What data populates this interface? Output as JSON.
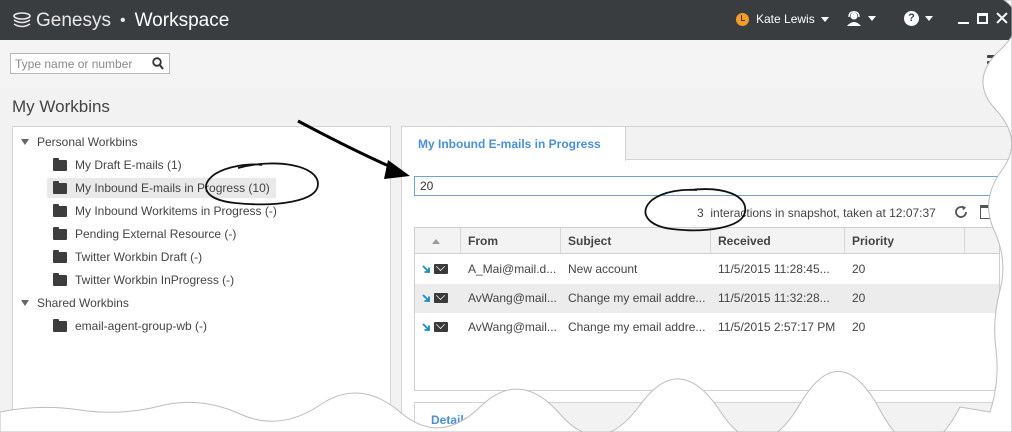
{
  "header": {
    "brand": "Genesys",
    "separator": "•",
    "product": "Workspace",
    "user_name": "Kate Lewis",
    "help_glyph": "?"
  },
  "search": {
    "placeholder": "Type name or number"
  },
  "page": {
    "title": "My Workbins"
  },
  "tree": {
    "groups": [
      {
        "label": "Personal Workbins",
        "items": [
          {
            "label": "My Draft E-mails (1)"
          },
          {
            "label": "My Inbound E-mails in Progress (10)"
          },
          {
            "label": "My Inbound Workitems in Progress (-)"
          },
          {
            "label": "Pending External Resource (-)"
          },
          {
            "label": "Twitter Workbin Draft (-)"
          },
          {
            "label": "Twitter Workbin InProgress (-)"
          }
        ]
      },
      {
        "label": "Shared Workbins",
        "items": [
          {
            "label": "email-agent-group-wb (-)"
          }
        ]
      }
    ]
  },
  "workbin": {
    "tab_label": "My Inbound E-mails in Progress",
    "filter_value": "20",
    "snapshot_count": "3",
    "snapshot_text": "interactions in snapshot, taken at 12:07:37",
    "columns": [
      "From",
      "Subject",
      "Received",
      "Priority"
    ],
    "rows": [
      {
        "from": "A_Mai@mail.d...",
        "subject": "New account",
        "received": "11/5/2015 11:28:45...",
        "priority": "20"
      },
      {
        "from": "AvWang@mail...",
        "subject": "Change my email addre...",
        "received": "11/5/2015 11:32:28...",
        "priority": "20"
      },
      {
        "from": "AvWang@mail...",
        "subject": "Change my email addre...",
        "received": "11/5/2015 2:57:17 PM",
        "priority": "20"
      }
    ],
    "details_tab": "Details"
  },
  "colors": {
    "topbar": "#3a3d40",
    "accent": "#4a8fd8",
    "presence": "#f39c26",
    "inbound_arrow": "#1a8ac8"
  }
}
